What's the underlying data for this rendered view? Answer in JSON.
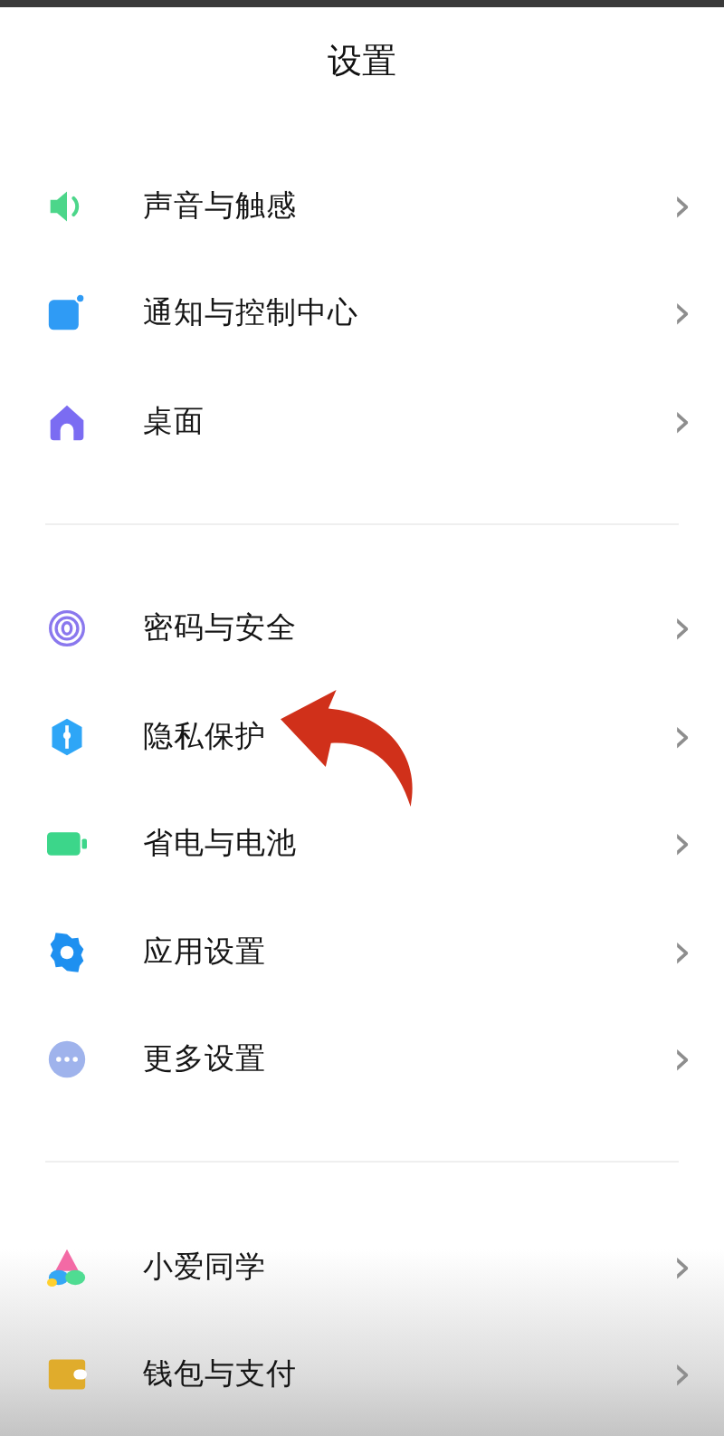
{
  "header": {
    "title": "设置"
  },
  "sections": [
    {
      "items": [
        {
          "kind": "sound",
          "label": "声音与触感",
          "chevron": "›"
        },
        {
          "kind": "notify",
          "label": "通知与控制中心",
          "chevron": "›"
        },
        {
          "kind": "home",
          "label": "桌面",
          "chevron": "›"
        }
      ]
    },
    {
      "items": [
        {
          "kind": "fingerprint",
          "label": "密码与安全",
          "chevron": "›"
        },
        {
          "kind": "privacy",
          "label": "隐私保护",
          "chevron": "›"
        },
        {
          "kind": "battery",
          "label": "省电与电池",
          "chevron": "›"
        },
        {
          "kind": "gear",
          "label": "应用设置",
          "chevron": "›"
        },
        {
          "kind": "more",
          "label": "更多设置",
          "chevron": "›"
        }
      ]
    },
    {
      "items": [
        {
          "kind": "assistant",
          "label": "小爱同学",
          "chevron": "›"
        },
        {
          "kind": "wallet",
          "label": "钱包与支付",
          "chevron": "›"
        }
      ]
    }
  ]
}
